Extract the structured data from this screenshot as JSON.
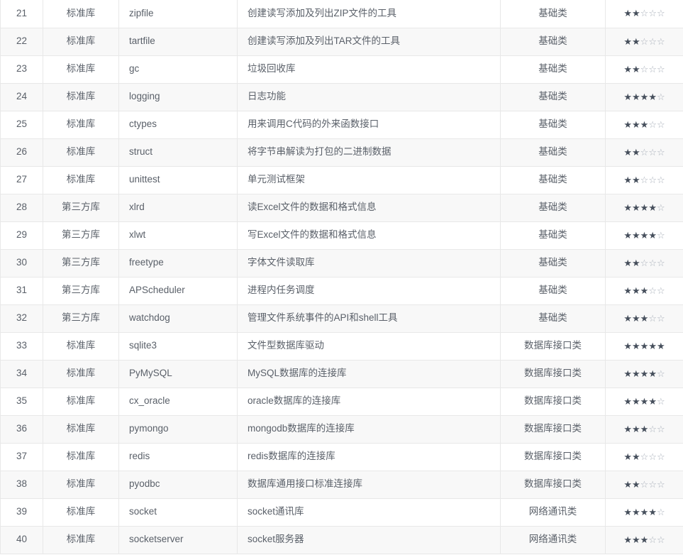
{
  "table": {
    "columns": [
      {
        "key": "id",
        "name": "index-column"
      },
      {
        "key": "kind",
        "name": "library-type-column"
      },
      {
        "key": "name",
        "name": "module-name-column"
      },
      {
        "key": "desc",
        "name": "description-column"
      },
      {
        "key": "cat",
        "name": "category-column"
      },
      {
        "key": "rating",
        "name": "rating-column"
      }
    ],
    "rating_max": 5,
    "star_full_glyph": "★",
    "star_empty_glyph": "☆",
    "rows": [
      {
        "id": "21",
        "kind": "标准库",
        "name": "zipfile",
        "desc": "创建读写添加及列出ZIP文件的工具",
        "cat": "基础类",
        "rating": 2
      },
      {
        "id": "22",
        "kind": "标准库",
        "name": "tartfile",
        "desc": "创建读写添加及列出TAR文件的工具",
        "cat": "基础类",
        "rating": 2
      },
      {
        "id": "23",
        "kind": "标准库",
        "name": "gc",
        "desc": "垃圾回收库",
        "cat": "基础类",
        "rating": 2
      },
      {
        "id": "24",
        "kind": "标准库",
        "name": "logging",
        "desc": "日志功能",
        "cat": "基础类",
        "rating": 4
      },
      {
        "id": "25",
        "kind": "标准库",
        "name": "ctypes",
        "desc": "用来调用C代码的外来函数接口",
        "cat": "基础类",
        "rating": 3
      },
      {
        "id": "26",
        "kind": "标准库",
        "name": "struct",
        "desc": "将字节串解读为打包的二进制数据",
        "cat": "基础类",
        "rating": 2
      },
      {
        "id": "27",
        "kind": "标准库",
        "name": "unittest",
        "desc": "单元测试框架",
        "cat": "基础类",
        "rating": 2
      },
      {
        "id": "28",
        "kind": "第三方库",
        "name": "xlrd",
        "desc": "读Excel文件的数据和格式信息",
        "cat": "基础类",
        "rating": 4
      },
      {
        "id": "29",
        "kind": "第三方库",
        "name": "xlwt",
        "desc": "写Excel文件的数据和格式信息",
        "cat": "基础类",
        "rating": 4
      },
      {
        "id": "30",
        "kind": "第三方库",
        "name": "freetype",
        "desc": "字体文件读取库",
        "cat": "基础类",
        "rating": 2
      },
      {
        "id": "31",
        "kind": "第三方库",
        "name": "APScheduler",
        "desc": "进程内任务调度",
        "cat": "基础类",
        "rating": 3
      },
      {
        "id": "32",
        "kind": "第三方库",
        "name": "watchdog",
        "desc": "管理文件系统事件的API和shell工具",
        "cat": "基础类",
        "rating": 3
      },
      {
        "id": "33",
        "kind": "标准库",
        "name": "sqlite3",
        "desc": "文件型数据库驱动",
        "cat": "数据库接口类",
        "rating": 5
      },
      {
        "id": "34",
        "kind": "标准库",
        "name": "PyMySQL",
        "desc": "MySQL数据库的连接库",
        "cat": "数据库接口类",
        "rating": 4
      },
      {
        "id": "35",
        "kind": "标准库",
        "name": "cx_oracle",
        "desc": "oracle数据库的连接库",
        "cat": "数据库接口类",
        "rating": 4
      },
      {
        "id": "36",
        "kind": "标准库",
        "name": "pymongo",
        "desc": "mongodb数据库的连接库",
        "cat": "数据库接口类",
        "rating": 3
      },
      {
        "id": "37",
        "kind": "标准库",
        "name": "redis",
        "desc": "redis数据库的连接库",
        "cat": "数据库接口类",
        "rating": 2
      },
      {
        "id": "38",
        "kind": "标准库",
        "name": "pyodbc",
        "desc": "数据库通用接口标准连接库",
        "cat": "数据库接口类",
        "rating": 2
      },
      {
        "id": "39",
        "kind": "标准库",
        "name": "socket",
        "desc": "socket通讯库",
        "cat": "网络通讯类",
        "rating": 4
      },
      {
        "id": "40",
        "kind": "标准库",
        "name": "socketserver",
        "desc": "socket服务器",
        "cat": "网络通讯类",
        "rating": 3
      }
    ]
  }
}
